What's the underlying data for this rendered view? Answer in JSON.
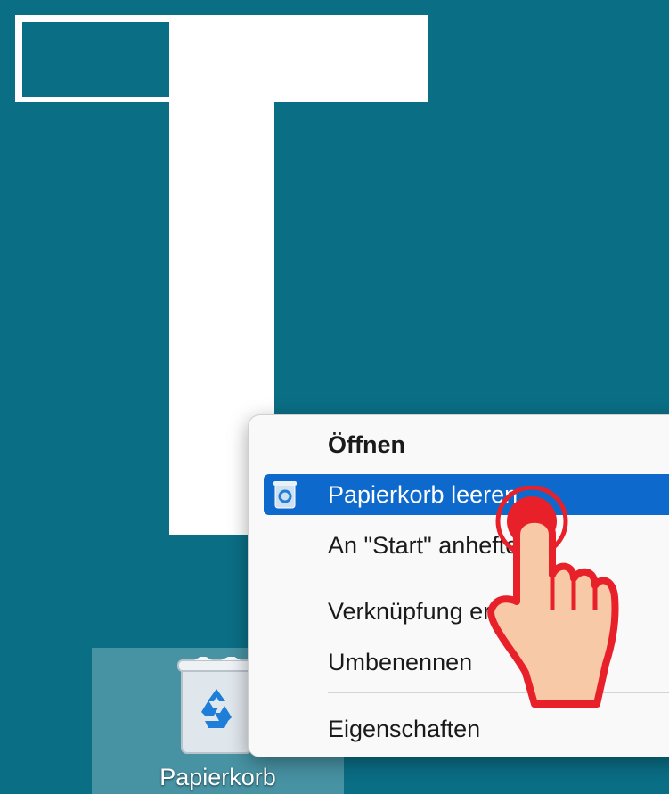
{
  "desktop": {
    "background_color": "#0a6e85",
    "icons": [
      {
        "label": "Papierkorb",
        "icon": "recycle-bin-icon"
      }
    ]
  },
  "context_menu": {
    "items": [
      {
        "label": "Öffnen",
        "bold": true
      },
      {
        "label": "Papierkorb leeren",
        "icon": "recycle-bin-icon",
        "highlighted": true
      },
      {
        "label": "An \"Start\" anheften"
      },
      {
        "label": "Verknüpfung erstellen"
      },
      {
        "label": "Umbenennen"
      },
      {
        "label": "Eigenschaften"
      }
    ],
    "highlight_color": "#0d69cc"
  },
  "overlay": {
    "icon": "pointing-hand-icon",
    "accent": "#e8202a"
  }
}
